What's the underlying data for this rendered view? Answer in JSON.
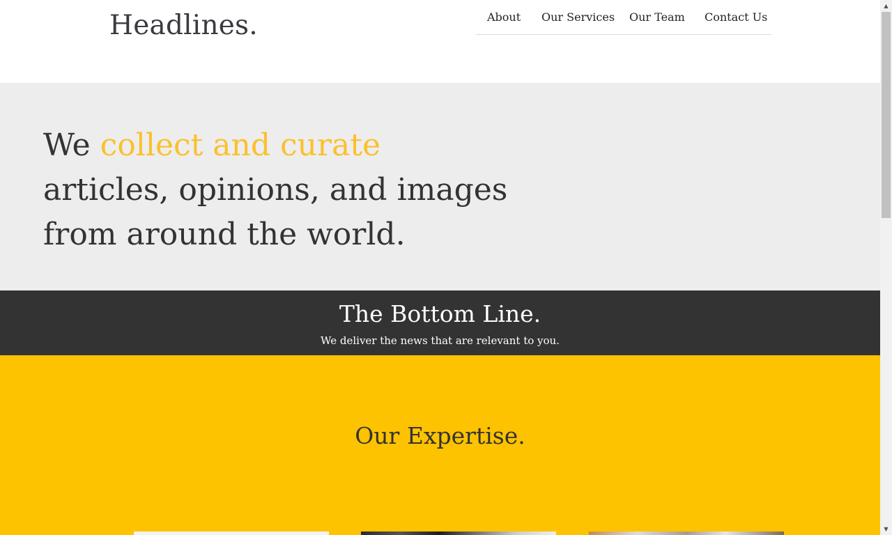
{
  "header": {
    "brand": "Headlines.",
    "nav": [
      "About",
      "Our Services",
      "Our Team",
      "Contact Us"
    ]
  },
  "hero": {
    "prefix": "We ",
    "accent": "collect and curate",
    "line2": "articles, opinions, and images",
    "line3": "from around the world."
  },
  "band": {
    "title": "The Bottom Line.",
    "subtitle": "We deliver the news that are relevant to you."
  },
  "expertise": {
    "title": "Our Expertise."
  },
  "colors": {
    "accent": "#fbc02d",
    "expertise_bg": "#fdc200",
    "band_bg": "#333333",
    "hero_bg": "#ededed"
  },
  "scrollbar": {
    "up_icon": "triangle-up-icon",
    "down_icon": "triangle-down-icon"
  }
}
